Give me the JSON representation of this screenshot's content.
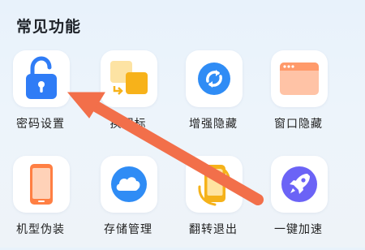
{
  "section": {
    "title": "常见功能"
  },
  "features": [
    {
      "label": "密码设置",
      "icon": "unlocked-padlock-icon",
      "color": "#2f7cf6"
    },
    {
      "label": "换图标",
      "icon": "change-icon-squares-icon",
      "color": "#f7b21a"
    },
    {
      "label": "增强隐藏",
      "icon": "refresh-circle-icon",
      "color": "#2f8cf5"
    },
    {
      "label": "窗口隐藏",
      "icon": "window-icon",
      "color": "#ff9a6a"
    },
    {
      "label": "机型伪装",
      "icon": "phone-icon",
      "color": "#ff7f43"
    },
    {
      "label": "存储管理",
      "icon": "cloud-storage-icon",
      "color": "#2f8cf5"
    },
    {
      "label": "翻转退出",
      "icon": "phone-rotate-icon",
      "color": "#f5b21a"
    },
    {
      "label": "一键加速",
      "icon": "rocket-icon",
      "color": "#6b63f6"
    }
  ],
  "annotation": {
    "arrow": "pointer-arrow",
    "color": "#f26f4a"
  }
}
